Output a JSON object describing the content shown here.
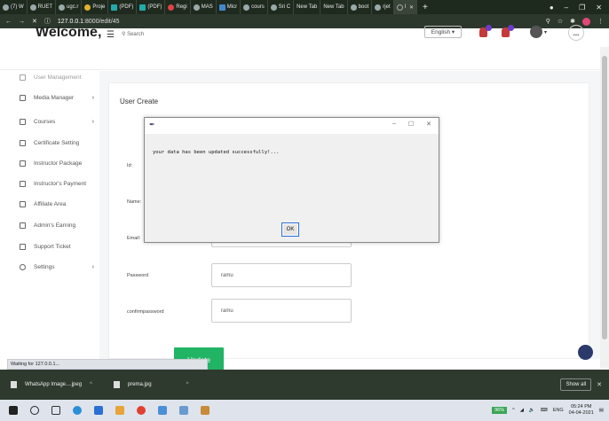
{
  "browser": {
    "tabs": [
      {
        "label": "(7) W"
      },
      {
        "label": "RUET"
      },
      {
        "label": "ugc.r"
      },
      {
        "label": "Proje"
      },
      {
        "label": "(PDF)"
      },
      {
        "label": "(PDF)"
      },
      {
        "label": "Regi"
      },
      {
        "label": "MAS"
      },
      {
        "label": "Micr"
      },
      {
        "label": "cours"
      },
      {
        "label": "Sri C"
      },
      {
        "label": "New Tab"
      },
      {
        "label": "New Tab"
      },
      {
        "label": "boot"
      },
      {
        "label": "rjet"
      },
      {
        "label": "l"
      }
    ],
    "new_tab": "+",
    "url_host": "127.0.0.1",
    "url_rest": ":8000/edit/45"
  },
  "header": {
    "welcome": "Welcome,",
    "search_placeholder": "Search",
    "language": "English",
    "more": "..."
  },
  "sidebar": {
    "items": [
      {
        "label": "User Management",
        "icon": "users-icon",
        "chevron": ""
      },
      {
        "label": "Media Manager",
        "icon": "media-icon",
        "chevron": "›"
      },
      {
        "label": "Courses",
        "icon": "book-icon",
        "chevron": "›"
      },
      {
        "label": "Certificate Setting",
        "icon": "certificate-icon",
        "chevron": ""
      },
      {
        "label": "Instructor Package",
        "icon": "package-icon",
        "chevron": ""
      },
      {
        "label": "Instructor's Payment",
        "icon": "payment-icon",
        "chevron": ""
      },
      {
        "label": "Affiliate Area",
        "icon": "affiliate-icon",
        "chevron": ""
      },
      {
        "label": "Admin's Earning",
        "icon": "earning-icon",
        "chevron": ""
      },
      {
        "label": "Support Ticket",
        "icon": "ticket-icon",
        "chevron": ""
      },
      {
        "label": "Settings",
        "icon": "gear-icon",
        "chevron": "›"
      }
    ]
  },
  "form": {
    "title": "User Create",
    "labels": {
      "id": "Id:",
      "name": "Name:",
      "email": "Email:",
      "password": "Password",
      "confirm": "confirmpassword"
    },
    "values": {
      "password": "ramu",
      "confirm": "ramu"
    },
    "update_label": "Update"
  },
  "dialog": {
    "message": "your data has been updated successfully!...",
    "ok_label": "OK",
    "minimize": "–",
    "maximize": "☐",
    "close": "✕"
  },
  "status": {
    "text": "Waiting for 127.0.0.1..."
  },
  "downloads": {
    "items": [
      {
        "name": "WhatsApp Image....jpeg"
      },
      {
        "name": "prema.jpg"
      }
    ],
    "show_all": "Show all",
    "close": "✕"
  },
  "taskbar": {
    "battery": "96%",
    "lang": "ENG",
    "time": "05:24 PM",
    "date": "04-04-2021"
  }
}
